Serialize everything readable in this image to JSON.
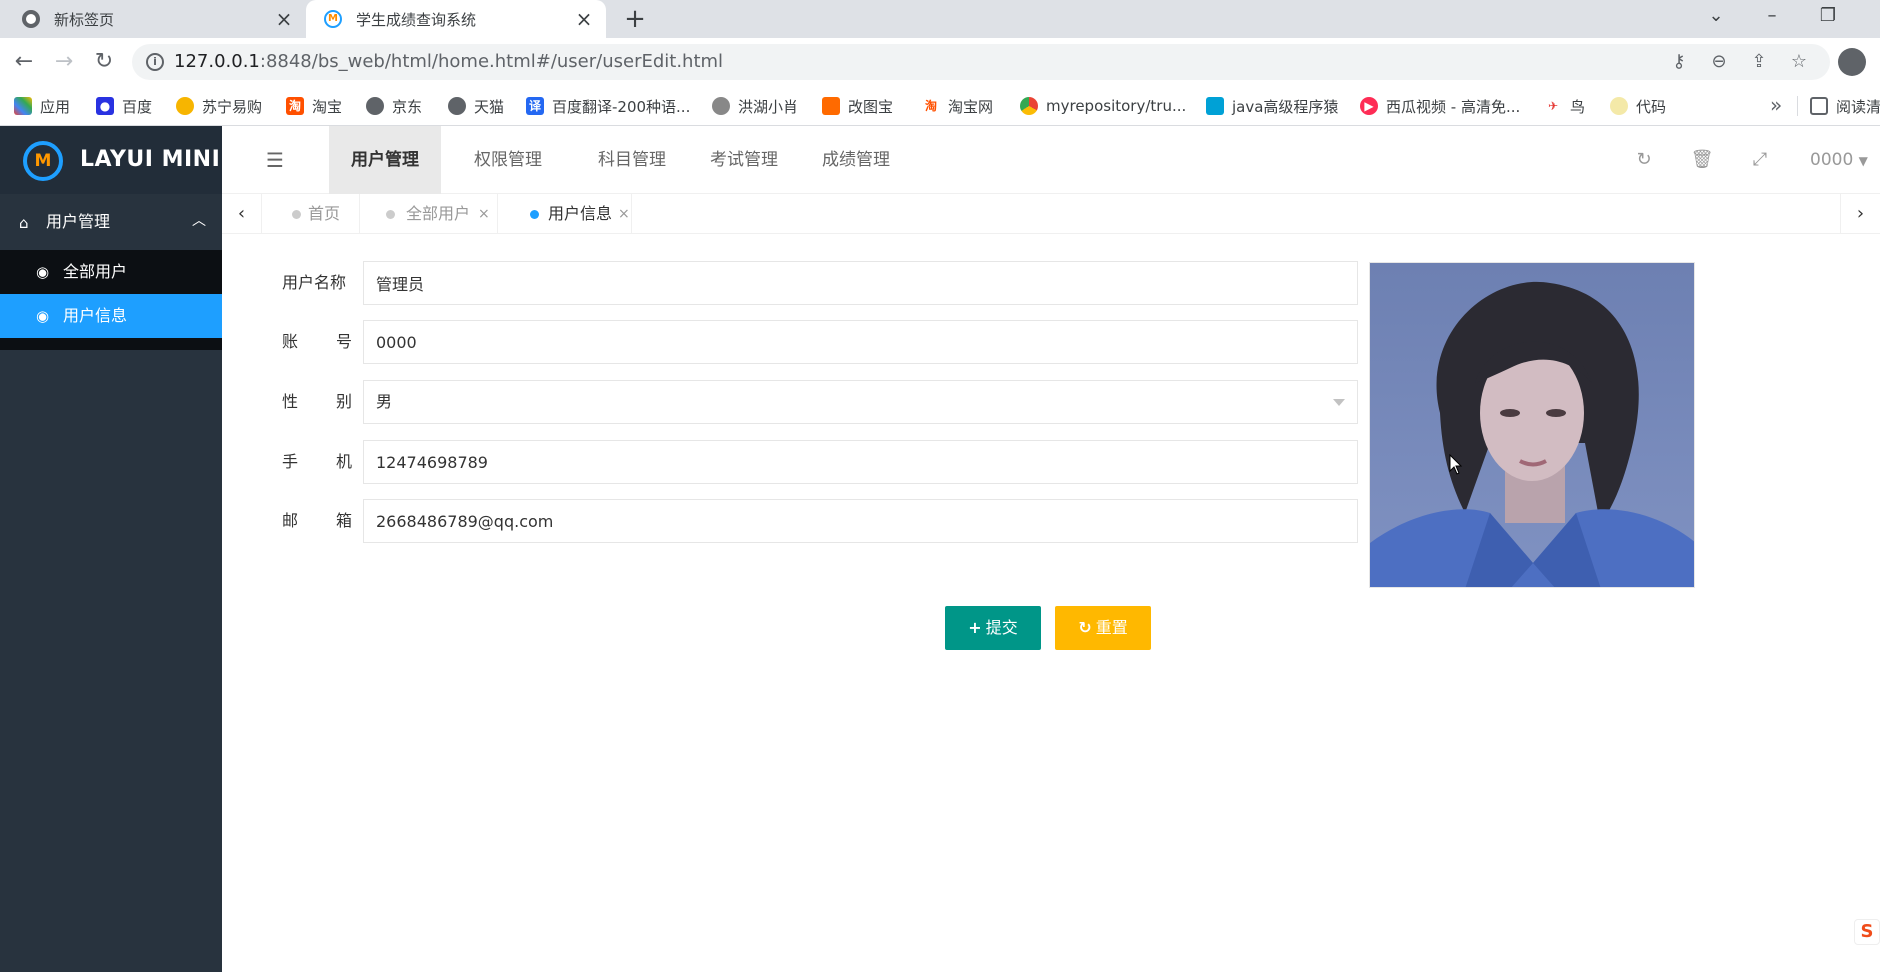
{
  "browser": {
    "tabs": [
      {
        "title": "新标签页"
      },
      {
        "title": "学生成绩查询系统"
      }
    ],
    "url_host": "127.0.0.1",
    "url_path": ":8848/bs_web/html/home.html#/user/userEdit.html",
    "bookmarks": [
      {
        "label": "应用"
      },
      {
        "label": "百度"
      },
      {
        "label": "苏宁易购"
      },
      {
        "label": "淘宝"
      },
      {
        "label": "京东"
      },
      {
        "label": "天猫"
      },
      {
        "label": "百度翻译-200种语..."
      },
      {
        "label": "洪湖小肖"
      },
      {
        "label": "改图宝"
      },
      {
        "label": "淘宝网"
      },
      {
        "label": "myrepository/tru..."
      },
      {
        "label": "java高级程序猿"
      },
      {
        "label": "西瓜视频 - 高清免..."
      },
      {
        "label": "鸟"
      },
      {
        "label": "代码"
      }
    ],
    "reading_list": "阅读清"
  },
  "app": {
    "logo": "LAYUI MINI",
    "sidebar": {
      "parent": "用户管理",
      "items": [
        {
          "label": "全部用户"
        },
        {
          "label": "用户信息"
        }
      ]
    },
    "topnav": [
      {
        "label": "用户管理"
      },
      {
        "label": "权限管理"
      },
      {
        "label": "科目管理"
      },
      {
        "label": "考试管理"
      },
      {
        "label": "成绩管理"
      }
    ],
    "user": "0000",
    "pagetabs": [
      {
        "label": "首页"
      },
      {
        "label": "全部用户"
      },
      {
        "label": "用户信息"
      }
    ]
  },
  "form": {
    "username": {
      "label": "用户名称",
      "value": "管理员"
    },
    "account": {
      "label_a": "账",
      "label_b": "号",
      "value": "0000"
    },
    "gender": {
      "label_a": "性",
      "label_b": "别",
      "value": "男"
    },
    "phone": {
      "label_a": "手",
      "label_b": "机",
      "value": "12474698789"
    },
    "email": {
      "label_a": "邮",
      "label_b": "箱",
      "value": "2668486789@qq.com"
    },
    "submit": "提交",
    "reset": "重置"
  },
  "colors": {
    "sidebar_bg": "#28333e",
    "logo_bg": "#222d39",
    "active_blue": "#1e9fff",
    "submit_green": "#009688",
    "reset_orange": "#ffb800"
  }
}
